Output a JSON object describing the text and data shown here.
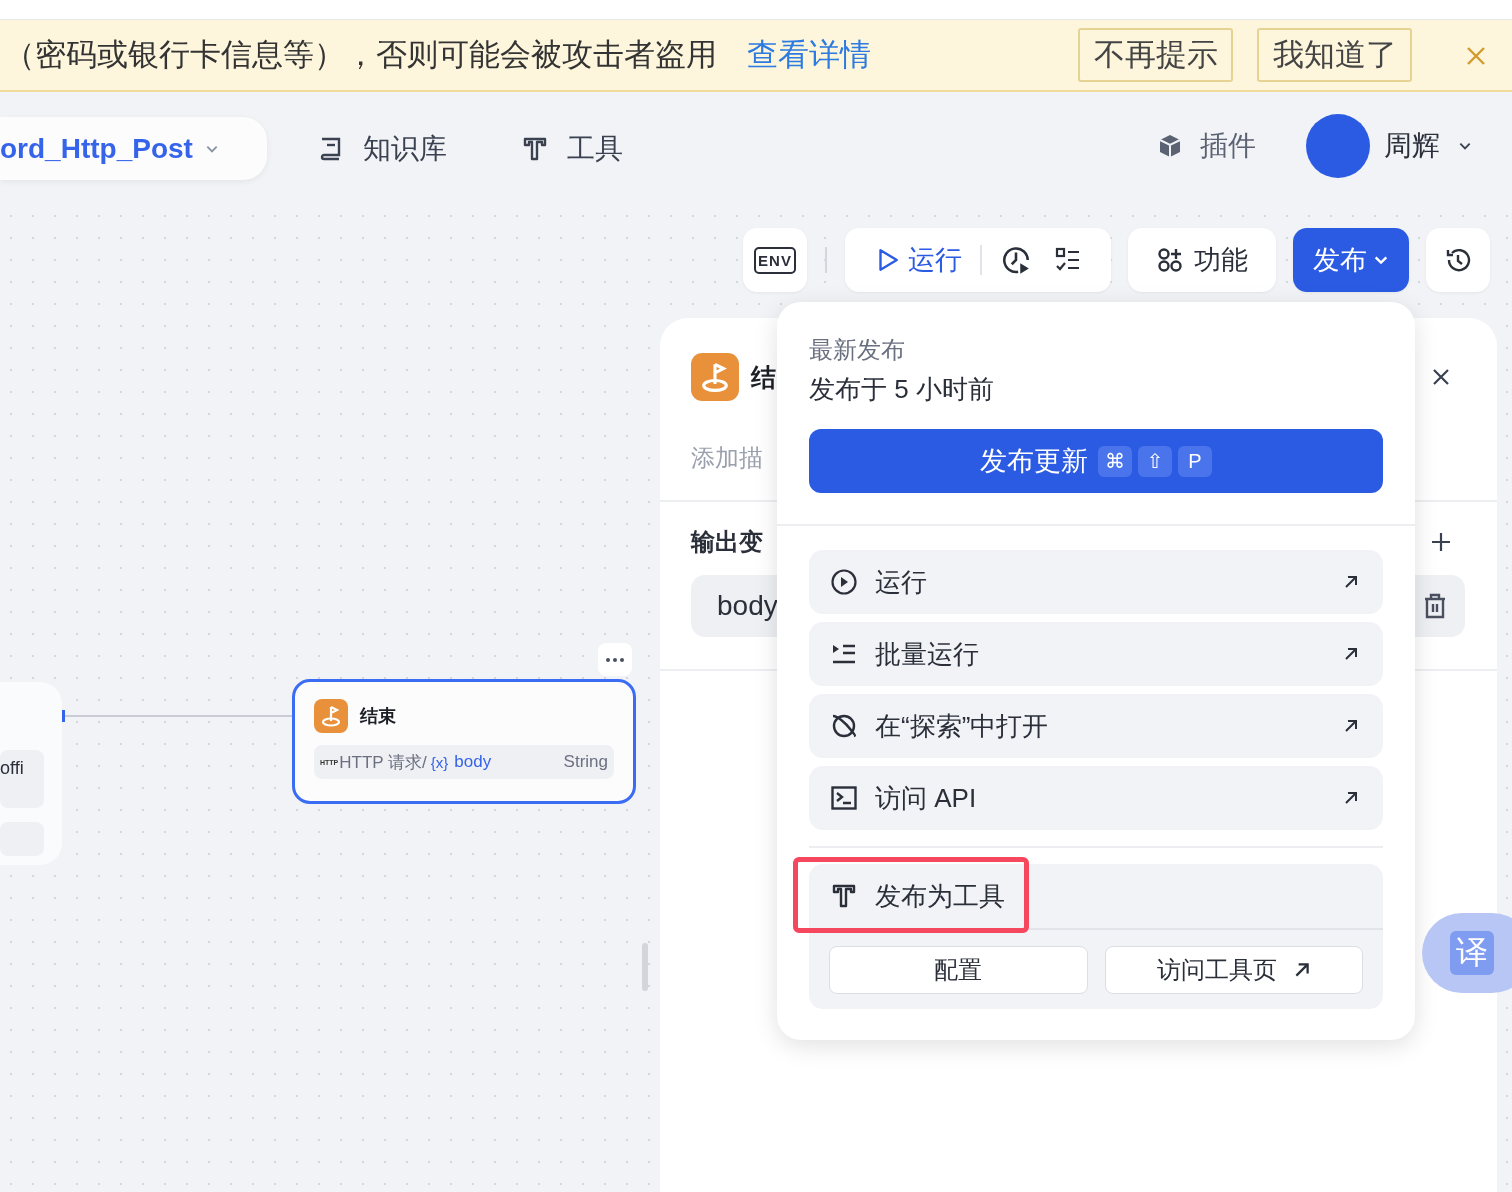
{
  "banner": {
    "message": "（密码或银行卡信息等），否则可能会被攻击者盗用",
    "link": "查看详情",
    "buttons": [
      "不再提示",
      "我知道了"
    ]
  },
  "header": {
    "project": "ord_Http_Post",
    "nav": [
      {
        "kind": "book",
        "label": "知识库"
      },
      {
        "kind": "tool",
        "label": "工具"
      }
    ],
    "plugins": "插件",
    "user": "周辉"
  },
  "toolbar": {
    "env": "ENV",
    "run": "运行",
    "features": "功能",
    "publish": "发布"
  },
  "canvas": {
    "left_node": {
      "row_text": "offi"
    },
    "end_node": {
      "title": "结束",
      "badge": "HTTP",
      "source": "HTTP 请求/",
      "var_icon": "{x}",
      "variable": "body",
      "type": "String",
      "selected": true
    }
  },
  "panel": {
    "title": "结",
    "description_placeholder": "添加描",
    "section": "输出变",
    "field": "body"
  },
  "publish_menu": {
    "label": "最新发布",
    "time": "发布于 5 小时前",
    "button": "发布更新",
    "shortcut": [
      "⌘",
      "⇧",
      "P"
    ],
    "items": [
      {
        "kind": "run",
        "label": "运行"
      },
      {
        "kind": "batch",
        "label": "批量运行"
      },
      {
        "kind": "explore",
        "label": "在“探索”中打开"
      },
      {
        "kind": "api",
        "label": "访问 API"
      }
    ],
    "tool": {
      "label": "发布为工具",
      "highlighted": true,
      "buttons": [
        {
          "label": "配置",
          "external": false
        },
        {
          "label": "访问工具页",
          "external": true
        }
      ]
    }
  },
  "translate": "译"
}
